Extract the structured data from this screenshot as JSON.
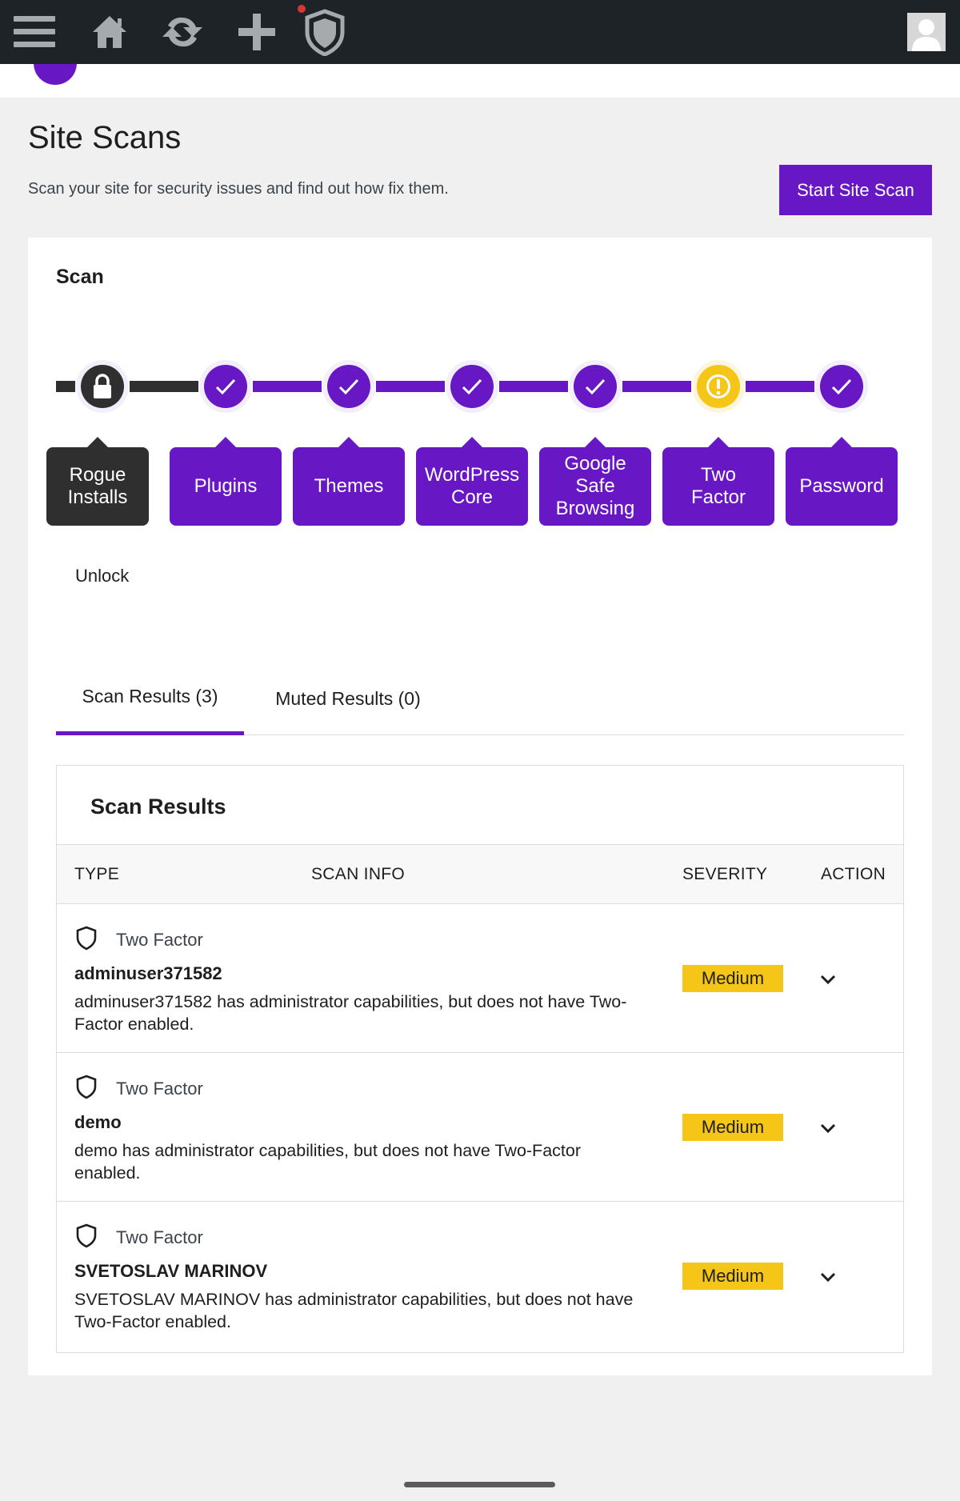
{
  "admin_bar": {
    "icons": [
      "menu-icon",
      "home-icon",
      "refresh-icon",
      "plus-icon",
      "shield-icon"
    ],
    "colors": {
      "background": "#1d2327",
      "notification_dot": "#d63638"
    }
  },
  "header": {
    "title": "Site Scans",
    "description": "Scan your site for security issues and find out how fix them.",
    "start_button": "Start Site Scan"
  },
  "scan_card": {
    "title": "Scan",
    "steps": [
      {
        "label": "Rogue Installs",
        "status": "locked",
        "icon": "lock-icon"
      },
      {
        "label": "Plugins",
        "status": "passed",
        "icon": "check-icon"
      },
      {
        "label": "Themes",
        "status": "passed",
        "icon": "check-icon"
      },
      {
        "label": "WordPress Core",
        "status": "passed",
        "icon": "check-icon"
      },
      {
        "label": "Google Safe Browsing",
        "status": "passed",
        "icon": "check-icon"
      },
      {
        "label": "Two Factor",
        "status": "warning",
        "icon": "warning-icon"
      },
      {
        "label": "Password",
        "status": "passed",
        "icon": "check-icon"
      }
    ],
    "unlock_link": "Unlock"
  },
  "tabs": [
    {
      "label": "Scan Results (3)",
      "active": true
    },
    {
      "label": "Muted Results (0)",
      "active": false
    }
  ],
  "results": {
    "title": "Scan Results",
    "columns": [
      "TYPE",
      "SCAN INFO",
      "SEVERITY",
      "ACTION"
    ],
    "rows": [
      {
        "type": "Two Factor",
        "user": "adminuser371582",
        "description": "adminuser371582 has administrator capabilities, but does not have Two-Factor enabled.",
        "severity": "Medium"
      },
      {
        "type": "Two Factor",
        "user": "demo",
        "description": "demo has administrator capabilities, but does not have Two-Factor enabled.",
        "severity": "Medium"
      },
      {
        "type": "Two Factor",
        "user": "SVETOSLAV MARINOV",
        "description": "SVETOSLAV MARINOV has administrator capabilities, but does not have Two-Factor enabled.",
        "severity": "Medium"
      }
    ]
  },
  "colors": {
    "accent": "#6817c5",
    "locked": "#2f2f2f",
    "warning": "#f5c518",
    "badge_medium": "#f5c518"
  }
}
